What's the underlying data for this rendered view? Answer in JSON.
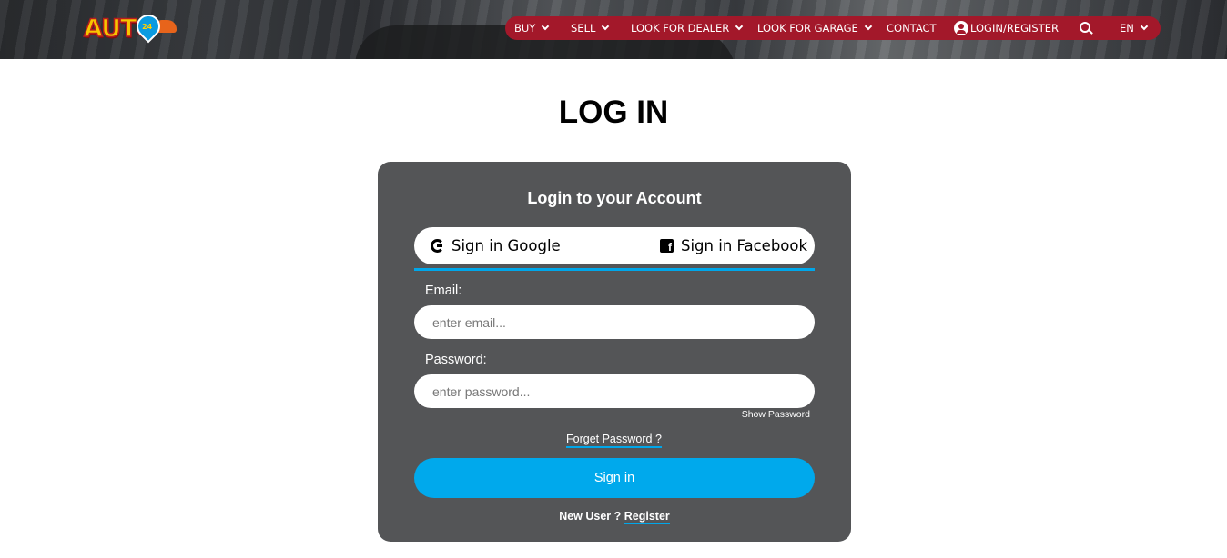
{
  "header": {
    "logo_text": "AUTO",
    "logo_badge": "24",
    "nav": {
      "buy": "BUY",
      "sell": "SELL",
      "look_for_dealer": "LOOK FOR DEALER",
      "look_for_garage": "LOOK FOR GARAGE",
      "contact": "CONTACT",
      "login_register": "LOGIN/REGISTER",
      "language": "EN"
    },
    "nav_color": "#a3182a"
  },
  "page": {
    "title": "LOG IN"
  },
  "card": {
    "title": "Login to your Account",
    "google_label": "Sign in Google",
    "facebook_label": "Sign in Facebook",
    "email_label": "Email:",
    "email_placeholder": "enter email...",
    "password_label": "Password:",
    "password_placeholder": "enter password...",
    "show_password": "Show Password",
    "forget_password": "Forget Password ?",
    "signin_button": "Sign in",
    "new_user_text": "New User ?",
    "register_link": "Register",
    "accent_color": "#00a9ec",
    "card_color": "#545557"
  },
  "icons": [
    "user-icon",
    "search-icon",
    "google-icon",
    "facebook-icon",
    "chevron-down-icon"
  ]
}
